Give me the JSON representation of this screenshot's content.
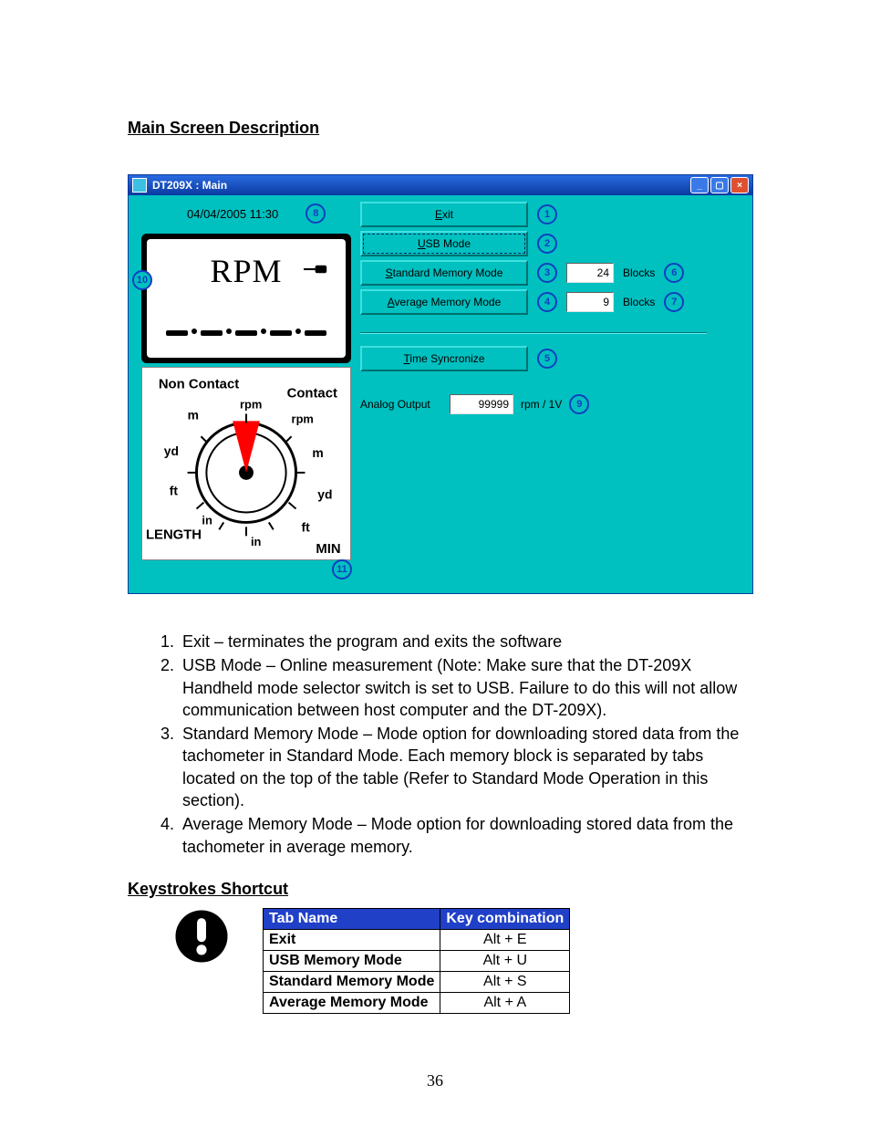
{
  "headings": {
    "main": "Main Screen Description",
    "shortcut": "Keystrokes Shortcut"
  },
  "window": {
    "title": "DT209X : Main",
    "datetime": "04/04/2005 11:30",
    "lcd_label": "RPM",
    "buttons": {
      "exit": "Exit",
      "usb": "USB Mode",
      "std": "Standard Memory Mode",
      "avg": "Average Memory Mode",
      "time": "Time Syncronize"
    },
    "std_blocks_value": "24",
    "avg_blocks_value": "9",
    "blocks_label": "Blocks",
    "analog_label": "Analog Output",
    "analog_value": "99999",
    "analog_unit": "rpm / 1V",
    "dial": {
      "non_contact": "Non Contact",
      "contact": "Contact",
      "length": "LENGTH",
      "min": "MIN",
      "rpm": "rpm",
      "m": "m",
      "yd": "yd",
      "ft": "ft",
      "in": "in"
    },
    "callouts": {
      "c1": "1",
      "c2": "2",
      "c3": "3",
      "c4": "4",
      "c5": "5",
      "c6": "6",
      "c7": "7",
      "c8": "8",
      "c9": "9",
      "c10": "10",
      "c11": "11"
    }
  },
  "list": {
    "i1": "Exit – terminates the program and exits the software",
    "i2": "USB Mode – Online measurement  (Note:  Make sure that the DT-209X Handheld mode selector switch is set to USB.  Failure to do this will not allow communication between host computer and  the DT-209X).",
    "i3": "Standard Memory Mode – Mode option for downloading stored data from the tachometer in Standard Mode.  Each memory block is separated by tabs located on the top of the table (Refer to Standard Mode Operation in this section).",
    "i4": "Average Memory Mode – Mode option for downloading stored data from the tachometer in average memory."
  },
  "table": {
    "head_tab": "Tab Name",
    "head_key": "Key combination",
    "rows": [
      {
        "name": "Exit",
        "key": "Alt + E"
      },
      {
        "name": "USB Memory Mode",
        "key": "Alt + U"
      },
      {
        "name": "Standard Memory Mode",
        "key": "Alt + S"
      },
      {
        "name": "Average Memory Mode",
        "key": "Alt + A"
      }
    ]
  },
  "page_number": "36"
}
